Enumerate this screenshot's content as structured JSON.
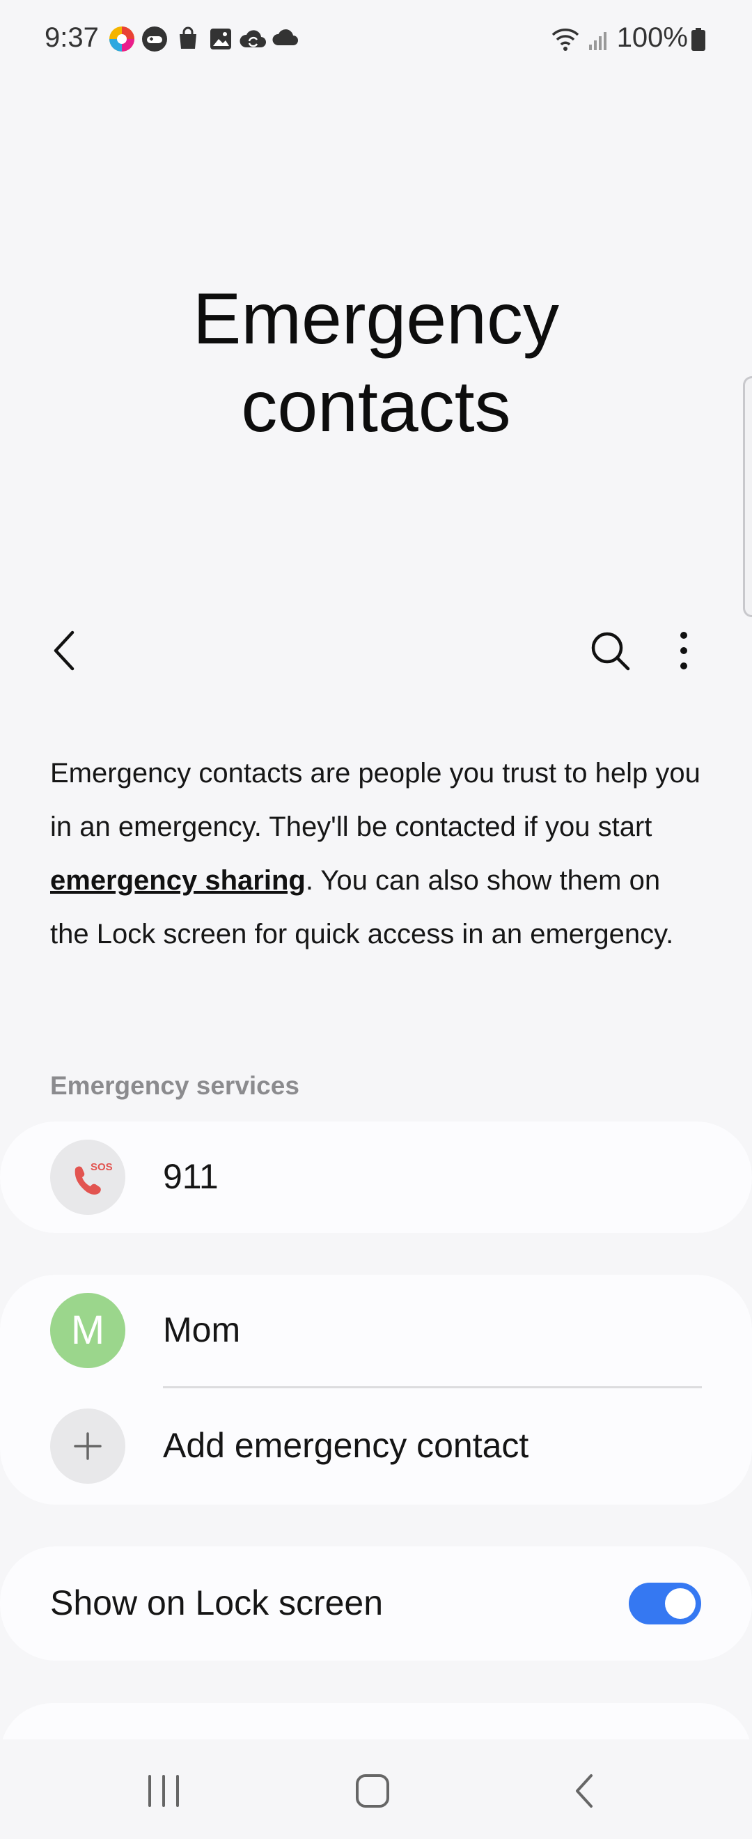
{
  "status_bar": {
    "time": "9:37",
    "battery": "100%",
    "notification_icons": [
      "app-color-icon",
      "game-controller-icon",
      "shopping-bag-icon",
      "gallery-icon",
      "cloud-sync-icon",
      "cloud-icon"
    ],
    "system_icons": [
      "wifi-icon",
      "signal-icon",
      "battery-icon"
    ]
  },
  "header": {
    "title_line1": "Emergency",
    "title_line2": "contacts"
  },
  "description": {
    "part1": "Emergency contacts are people you trust to help you in an emergency. They'll be contacted if you start ",
    "link": "emergency sharing",
    "part2": ". You can also show them on the Lock screen for quick access in an emergency."
  },
  "emergency_services": {
    "section_label": "Emergency services",
    "number": "911",
    "badge": "SOS"
  },
  "contacts": {
    "items": [
      {
        "initial": "M",
        "name": "Mom"
      }
    ],
    "add_label": "Add emergency contact"
  },
  "lock_screen": {
    "label": "Show on Lock screen",
    "enabled": true
  },
  "colors": {
    "accent": "#3578f2",
    "avatar": "#9bd68c",
    "sos": "#e25450"
  }
}
